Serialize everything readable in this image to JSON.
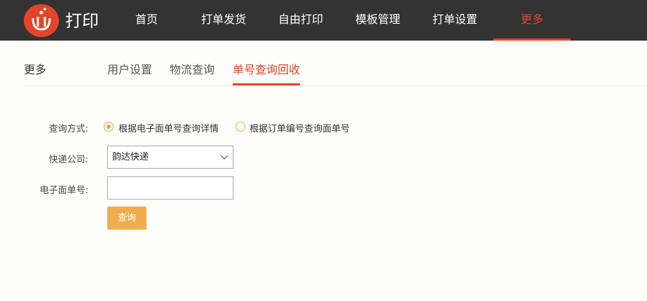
{
  "header": {
    "brand": "打印",
    "nav": [
      {
        "label": "首页"
      },
      {
        "label": "打单发货"
      },
      {
        "label": "自由打印"
      },
      {
        "label": "模板管理"
      },
      {
        "label": "打单设置"
      },
      {
        "label": "更多",
        "active": true
      }
    ]
  },
  "sub_header": {
    "title": "更多",
    "tabs": [
      {
        "label": "用户设置"
      },
      {
        "label": "物流查询"
      },
      {
        "label": "单号查询回收",
        "active": true
      }
    ]
  },
  "form": {
    "query_method_label": "查询方式:",
    "options": [
      {
        "label": "根据电子面单号查询详情",
        "checked": true
      },
      {
        "label": "根据订单编号查询面单号",
        "checked": false
      }
    ],
    "courier_label": "快递公司:",
    "courier_value": "韵达快递",
    "waybill_label": "电子面单号:",
    "waybill_value": "",
    "query_button": "查询"
  },
  "colors": {
    "accent": "#e2452a",
    "radio": "#e8a33b",
    "button": "#f0ad4e",
    "topbar": "#333333"
  }
}
